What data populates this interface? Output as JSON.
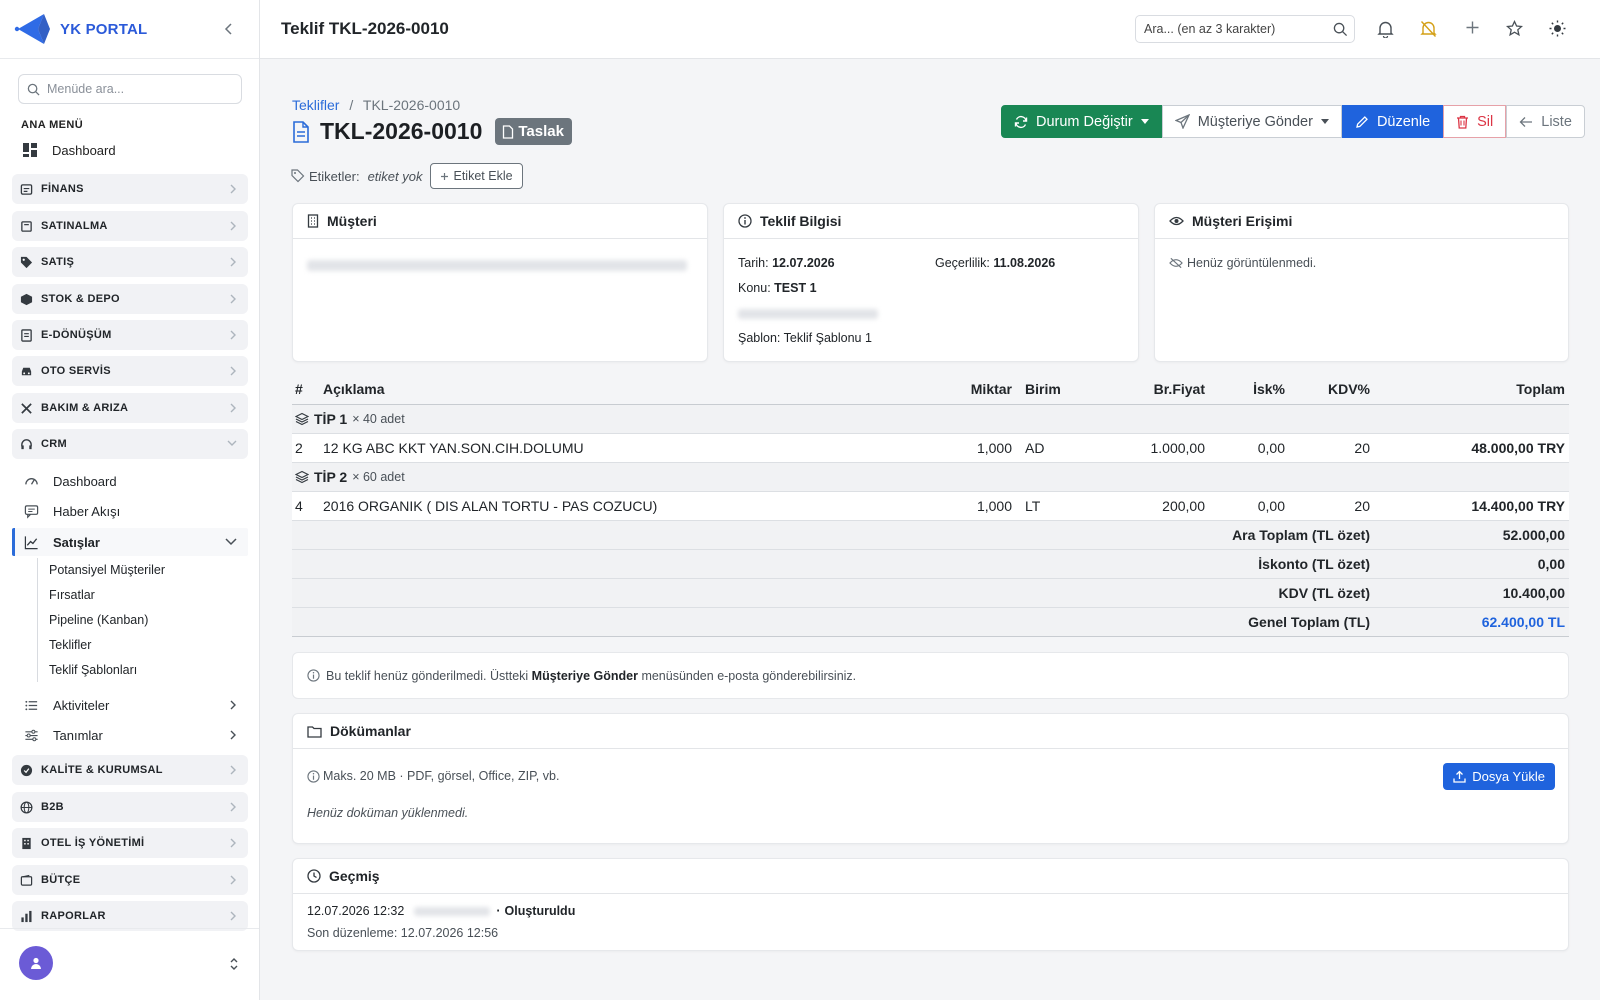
{
  "brand": {
    "name": "YK PORTAL"
  },
  "sidebar": {
    "search_placeholder": "Menüde ara...",
    "heading": "ANA MENÜ",
    "dashboard": "Dashboard",
    "groups": [
      {
        "label": "FİNANS",
        "icon": "finance-icon"
      },
      {
        "label": "SATINALMA",
        "icon": "cart-icon"
      },
      {
        "label": "SATIŞ",
        "icon": "tag-icon"
      },
      {
        "label": "STOK & DEPO",
        "icon": "box-icon"
      },
      {
        "label": "E-DÖNÜŞÜM",
        "icon": "document-icon"
      },
      {
        "label": "OTO SERVİS",
        "icon": "car-icon"
      },
      {
        "label": "BAKIM & ARIZA",
        "icon": "tools-icon"
      },
      {
        "label": "CRM",
        "icon": "headset-icon"
      }
    ],
    "crm_items": [
      {
        "label": "Dashboard",
        "icon": "gauge-icon"
      },
      {
        "label": "Haber Akışı",
        "icon": "chat-icon"
      },
      {
        "label": "Satışlar",
        "icon": "chart-line-icon"
      }
    ],
    "sales_items": [
      "Potansiyel Müşteriler",
      "Fırsatlar",
      "Pipeline (Kanban)",
      "Teklifler",
      "Teklif Şablonları"
    ],
    "crm_more": [
      {
        "label": "Aktiviteler",
        "icon": "list-icon"
      },
      {
        "label": "Tanımlar",
        "icon": "sliders-icon"
      }
    ],
    "groups2": [
      {
        "label": "KALİTE & KURUMSAL",
        "icon": "shield-icon"
      },
      {
        "label": "B2B",
        "icon": "globe-icon"
      },
      {
        "label": "OTEL İŞ YÖNETİMİ",
        "icon": "building-icon"
      },
      {
        "label": "BÜTÇE",
        "icon": "wallet-icon"
      },
      {
        "label": "RAPORLAR",
        "icon": "bar-chart-icon"
      }
    ]
  },
  "header": {
    "title": "Teklif TKL-2026-0010",
    "search_placeholder": "Ara... (en az 3 karakter)"
  },
  "breadcrumb": {
    "parent": "Teklifler",
    "separator": "/",
    "current": "TKL-2026-0010"
  },
  "doc": {
    "number": "TKL-2026-0010",
    "status": "Taslak"
  },
  "actions": {
    "status": "Durum Değiştir",
    "send": "Müşteriye Gönder",
    "edit": "Düzenle",
    "delete": "Sil",
    "list": "Liste"
  },
  "tags": {
    "label": "Etiketler:",
    "empty": "etiket yok",
    "add": "Etiket Ekle"
  },
  "customer_card": {
    "title": "Müşteri"
  },
  "info_card": {
    "title": "Teklif Bilgisi",
    "date_label": "Tarih:",
    "date": "12.07.2026",
    "valid_label": "Geçerlilik:",
    "valid": "11.08.2026",
    "subject_label": "Konu:",
    "subject": "TEST 1",
    "template_label": "Şablon:",
    "template": "Teklif Şablonu 1"
  },
  "access_card": {
    "title": "Müşteri Erişimi",
    "text": "Henüz görüntülenmedi."
  },
  "table": {
    "headers": {
      "no": "#",
      "desc": "Açıklama",
      "qty": "Miktar",
      "unit": "Birim",
      "price": "Br.Fiyat",
      "disc": "İsk%",
      "vat": "KDV%",
      "total": "Toplam"
    },
    "groups": [
      {
        "name": "TİP 1",
        "mult": "× 40 adet",
        "item": {
          "no": "2",
          "desc": "12 KG ABC KKT YAN.SON.CIH.DOLUMU",
          "qty": "1,000",
          "unit": "AD",
          "price": "1.000,00",
          "disc": "0,00",
          "vat": "20",
          "total": "48.000,00 TRY"
        }
      },
      {
        "name": "TİP 2",
        "mult": "× 60 adet",
        "item": {
          "no": "4",
          "desc": "2016 ORGANIK ( DIS ALAN TORTU - PAS COZUCU)",
          "qty": "1,000",
          "unit": "LT",
          "price": "200,00",
          "disc": "0,00",
          "vat": "20",
          "total": "14.400,00 TRY"
        }
      }
    ],
    "summary": [
      {
        "label": "Ara Toplam (TL özet)",
        "value": "52.000,00"
      },
      {
        "label": "İskonto (TL özet)",
        "value": "0,00"
      },
      {
        "label": "KDV (TL özet)",
        "value": "10.400,00"
      },
      {
        "label": "Genel Toplam (TL)",
        "value": "62.400,00 TL"
      }
    ]
  },
  "notice": {
    "pre": "Bu teklif henüz gönderilmedi. Üstteki",
    "bold": "Müşteriye Gönder",
    "post": "menüsünden e-posta gönderebilirsiniz."
  },
  "documents": {
    "title": "Dökümanlar",
    "limits": "Maks. 20 MB · PDF, görsel, Office, ZIP, vb.",
    "empty": "Henüz doküman yüklenmedi.",
    "upload": "Dosya Yükle"
  },
  "history": {
    "title": "Geçmiş",
    "entry_time": "12.07.2026 12:32",
    "entry_sep": "·",
    "entry_action": "Oluşturuldu",
    "last_edit": "Son düzenleme: 12.07.2026 12:56"
  },
  "colors": {
    "accent": "#1f63dd",
    "success": "#198754",
    "danger": "#dc3545",
    "badge": "#6c757d",
    "grand_total": "#1f63dd"
  }
}
